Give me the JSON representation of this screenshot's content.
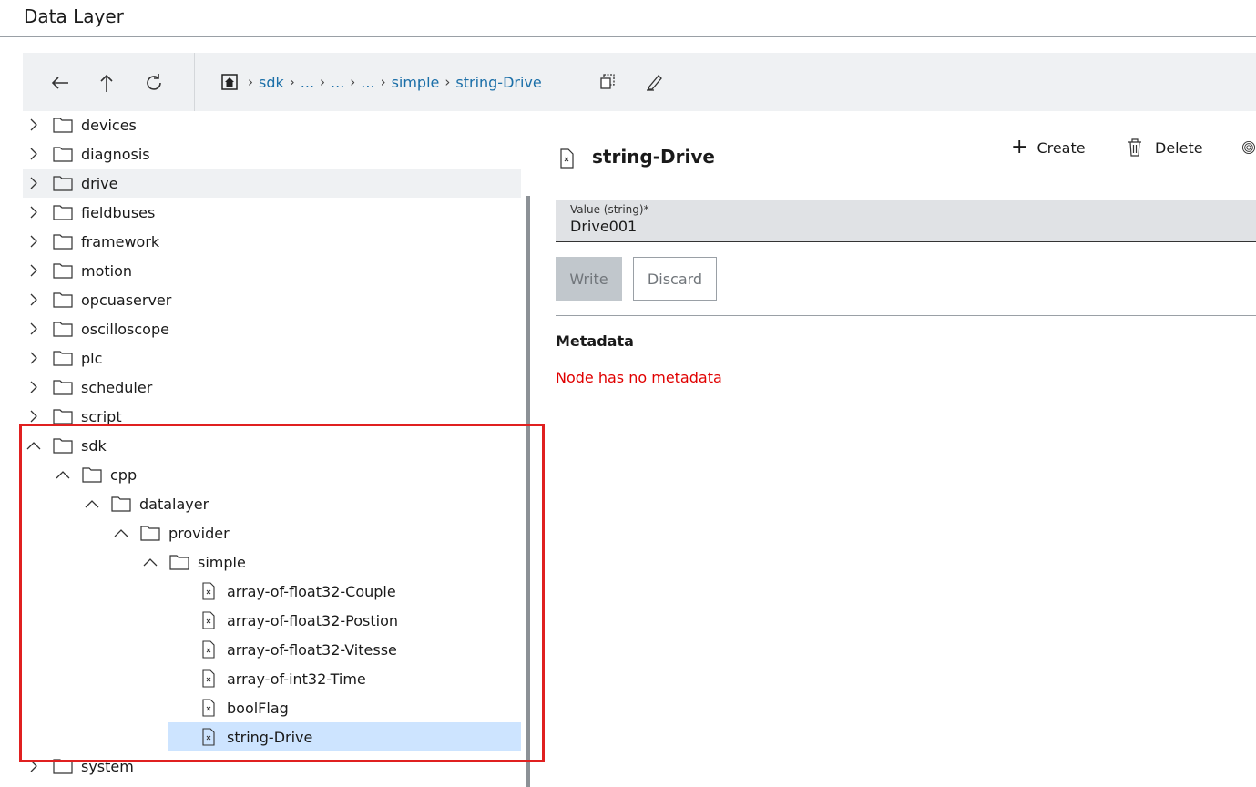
{
  "app": {
    "title": "Data Layer"
  },
  "toolbar": {
    "back_icon": "arrow-left-icon",
    "up_icon": "arrow-up-icon",
    "refresh_icon": "refresh-icon",
    "breadcrumb": [
      "sdk",
      "...",
      "...",
      "...",
      "simple",
      "string-Drive"
    ],
    "copy_icon": "copy-icon",
    "edit_icon": "edit-icon"
  },
  "tree": {
    "items": [
      {
        "label": "devices",
        "depth": 0,
        "expanded": false,
        "type": "folder"
      },
      {
        "label": "diagnosis",
        "depth": 0,
        "expanded": false,
        "type": "folder"
      },
      {
        "label": "drive",
        "depth": 0,
        "expanded": false,
        "type": "folder"
      },
      {
        "label": "fieldbuses",
        "depth": 0,
        "expanded": false,
        "type": "folder"
      },
      {
        "label": "framework",
        "depth": 0,
        "expanded": false,
        "type": "folder"
      },
      {
        "label": "motion",
        "depth": 0,
        "expanded": false,
        "type": "folder"
      },
      {
        "label": "opcuaserver",
        "depth": 0,
        "expanded": false,
        "type": "folder"
      },
      {
        "label": "oscilloscope",
        "depth": 0,
        "expanded": false,
        "type": "folder"
      },
      {
        "label": "plc",
        "depth": 0,
        "expanded": false,
        "type": "folder"
      },
      {
        "label": "scheduler",
        "depth": 0,
        "expanded": false,
        "type": "folder"
      },
      {
        "label": "script",
        "depth": 0,
        "expanded": false,
        "type": "folder"
      },
      {
        "label": "sdk",
        "depth": 0,
        "expanded": true,
        "type": "folder"
      },
      {
        "label": "cpp",
        "depth": 1,
        "expanded": true,
        "type": "folder"
      },
      {
        "label": "datalayer",
        "depth": 2,
        "expanded": true,
        "type": "folder"
      },
      {
        "label": "provider",
        "depth": 3,
        "expanded": true,
        "type": "folder"
      },
      {
        "label": "simple",
        "depth": 4,
        "expanded": true,
        "type": "folder"
      },
      {
        "label": "array-of-float32-Couple",
        "depth": 5,
        "type": "node"
      },
      {
        "label": "array-of-float32-Postion",
        "depth": 5,
        "type": "node"
      },
      {
        "label": "array-of-float32-Vitesse",
        "depth": 5,
        "type": "node"
      },
      {
        "label": "array-of-int32-Time",
        "depth": 5,
        "type": "node"
      },
      {
        "label": "boolFlag",
        "depth": 5,
        "type": "node"
      },
      {
        "label": "string-Drive",
        "depth": 5,
        "type": "node",
        "selected": true
      },
      {
        "label": "system",
        "depth": 0,
        "expanded": false,
        "type": "folder"
      }
    ]
  },
  "detail": {
    "title": "string-Drive",
    "create_label": "Create",
    "delete_label": "Delete",
    "field_label": "Value (string)*",
    "field_value": "Drive001",
    "write_label": "Write",
    "discard_label": "Discard",
    "metadata_title": "Metadata",
    "metadata_empty": "Node has no metadata"
  },
  "colors": {
    "link": "#1b6fa8",
    "selected": "#cde4ff",
    "error": "#e00000",
    "highlight": "#e02020"
  }
}
